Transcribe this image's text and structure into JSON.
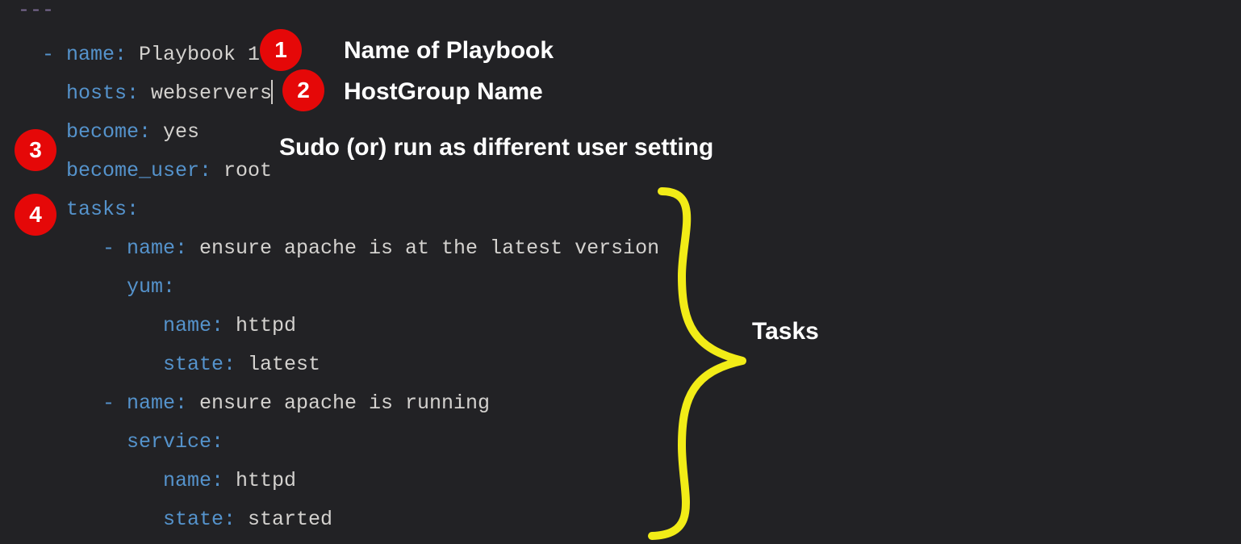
{
  "code": {
    "triple_dash": "---",
    "dash": "-",
    "keys": {
      "name": "name:",
      "hosts": "hosts:",
      "become": "become:",
      "become_user": "become_user:",
      "tasks": "tasks:",
      "yum": "yum:",
      "service": "service:",
      "state": "state:"
    },
    "vals": {
      "playbook_name": " Playbook 1",
      "hosts": " webservers",
      "become": " yes",
      "become_user": " root",
      "task1_name": " ensure apache is at the latest version",
      "task1_pkg": " httpd",
      "task1_state": " latest",
      "task2_name": " ensure apache is running",
      "task2_svc": " httpd",
      "task2_state": " started"
    }
  },
  "annotations": {
    "badges": {
      "b1": "1",
      "b2": "2",
      "b3": "3",
      "b4": "4"
    },
    "labels": {
      "l1": "Name of Playbook",
      "l2": "HostGroup Name",
      "l3": "Sudo (or) run as different user setting",
      "l4": "Tasks"
    }
  }
}
